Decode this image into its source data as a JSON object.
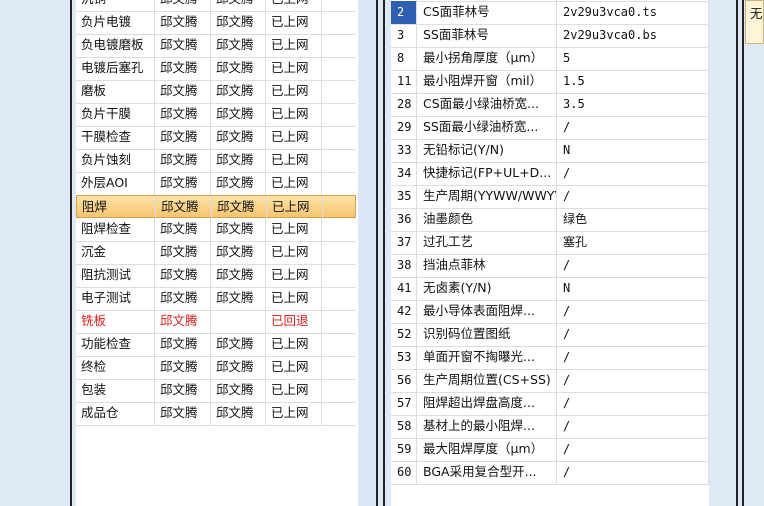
{
  "left_grid": {
    "rows": [
      {
        "step": "沉铜",
        "worker": "邱文腾",
        "reviewer": "邱文腾",
        "status": "已上网"
      },
      {
        "step": "负片电镀",
        "worker": "邱文腾",
        "reviewer": "邱文腾",
        "status": "已上网"
      },
      {
        "step": "负电镀磨板",
        "worker": "邱文腾",
        "reviewer": "邱文腾",
        "status": "已上网"
      },
      {
        "step": "电镀后塞孔",
        "worker": "邱文腾",
        "reviewer": "邱文腾",
        "status": "已上网"
      },
      {
        "step": "磨板",
        "worker": "邱文腾",
        "reviewer": "邱文腾",
        "status": "已上网"
      },
      {
        "step": "负片干膜",
        "worker": "邱文腾",
        "reviewer": "邱文腾",
        "status": "已上网"
      },
      {
        "step": "干膜检查",
        "worker": "邱文腾",
        "reviewer": "邱文腾",
        "status": "已上网"
      },
      {
        "step": "负片蚀刻",
        "worker": "邱文腾",
        "reviewer": "邱文腾",
        "status": "已上网"
      },
      {
        "step": "外层AOI",
        "worker": "邱文腾",
        "reviewer": "邱文腾",
        "status": "已上网"
      },
      {
        "step": "阻焊",
        "worker": "邱文腾",
        "reviewer": "邱文腾",
        "status": "已上网",
        "selected": true
      },
      {
        "step": "阻焊检查",
        "worker": "邱文腾",
        "reviewer": "邱文腾",
        "status": "已上网"
      },
      {
        "step": "沉金",
        "worker": "邱文腾",
        "reviewer": "邱文腾",
        "status": "已上网"
      },
      {
        "step": "阻抗测试",
        "worker": "邱文腾",
        "reviewer": "邱文腾",
        "status": "已上网"
      },
      {
        "step": "电子测试",
        "worker": "邱文腾",
        "reviewer": "邱文腾",
        "status": "已上网"
      },
      {
        "step": "铣板",
        "worker": "邱文腾",
        "reviewer": "",
        "status": "已回退",
        "red": true
      },
      {
        "step": "功能检查",
        "worker": "邱文腾",
        "reviewer": "邱文腾",
        "status": "已上网"
      },
      {
        "step": "终检",
        "worker": "邱文腾",
        "reviewer": "邱文腾",
        "status": "已上网"
      },
      {
        "step": "包装",
        "worker": "邱文腾",
        "reviewer": "邱文腾",
        "status": "已上网"
      },
      {
        "step": "成品仓",
        "worker": "邱文腾",
        "reviewer": "邱文腾",
        "status": "已上网"
      }
    ]
  },
  "right_grid": {
    "rows": [
      {
        "id": "",
        "param": "",
        "value": ""
      },
      {
        "id": "2",
        "param": "CS面菲林号",
        "value": "2v29u3vca0.ts",
        "selected": true
      },
      {
        "id": "3",
        "param": "SS面菲林号",
        "value": "2v29u3vca0.bs"
      },
      {
        "id": "8",
        "param": "最小拐角厚度（μm）",
        "value": "5"
      },
      {
        "id": "11",
        "param": "最小阻焊开窗（mil）",
        "value": "1.5"
      },
      {
        "id": "28",
        "param": "CS面最小绿油桥宽...",
        "value": "3.5"
      },
      {
        "id": "29",
        "param": "SS面最小绿油桥宽...",
        "value": "/"
      },
      {
        "id": "33",
        "param": "无铅标记(Y/N)",
        "value": "N"
      },
      {
        "id": "34",
        "param": "快捷标记(FP+UL+D...",
        "value": "/"
      },
      {
        "id": "35",
        "param": "生产周期(YYWW/WWYY)",
        "value": "/"
      },
      {
        "id": "36",
        "param": "油墨颜色",
        "value": "绿色"
      },
      {
        "id": "37",
        "param": "过孔工艺",
        "value": "塞孔"
      },
      {
        "id": "38",
        "param": "挡油点菲林",
        "value": "/"
      },
      {
        "id": "41",
        "param": "无卤素(Y/N)",
        "value": "N"
      },
      {
        "id": "42",
        "param": "最小导体表面阻焊...",
        "value": "/"
      },
      {
        "id": "52",
        "param": "识别码位置图纸",
        "value": "/"
      },
      {
        "id": "53",
        "param": "单面开窗不掏曝光...",
        "value": "/"
      },
      {
        "id": "56",
        "param": "生产周期位置(CS+SS)",
        "value": "/"
      },
      {
        "id": "57",
        "param": "阻焊超出焊盘高度...",
        "value": "/"
      },
      {
        "id": "58",
        "param": "基材上的最小阻焊...",
        "value": "/"
      },
      {
        "id": "59",
        "param": "最大阻焊厚度（μm）",
        "value": "/"
      },
      {
        "id": "60",
        "param": "BGA采用复合型开...",
        "value": "/"
      }
    ]
  },
  "side_panel": {
    "label": "无"
  }
}
